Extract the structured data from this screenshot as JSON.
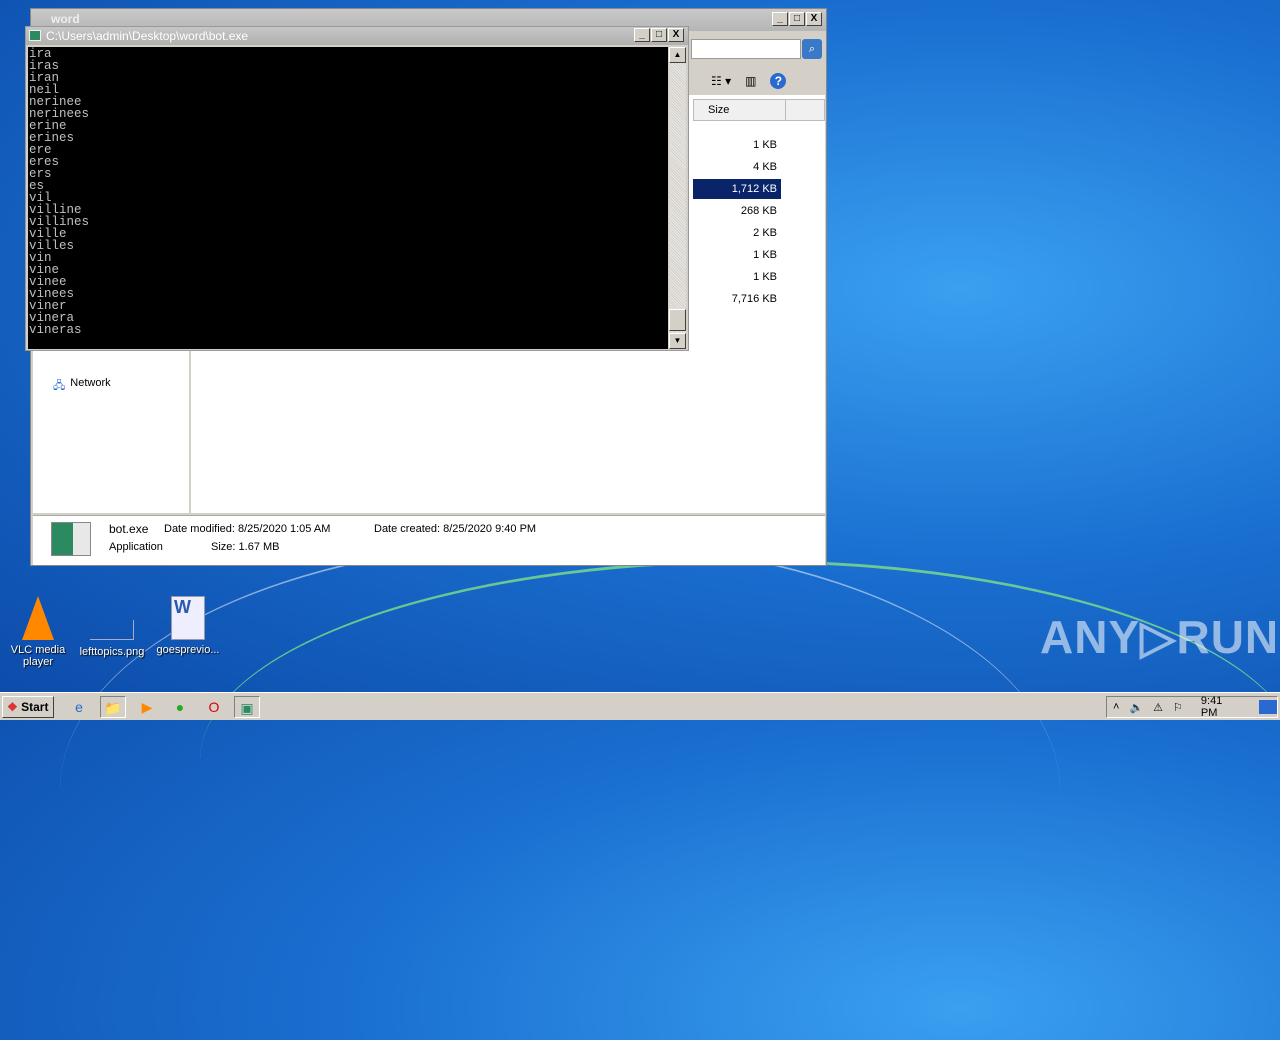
{
  "desktop": {
    "icons": [
      {
        "label": "VLC media player",
        "icon": "vlc-icon"
      },
      {
        "label": "lefttopics.png",
        "icon": "image-icon"
      },
      {
        "label": "goesprevio...",
        "icon": "word-doc-icon"
      }
    ],
    "watermark": "ANY ▷ RUN"
  },
  "explorer": {
    "title": "word",
    "column_size": "Size",
    "sizes": [
      "1 KB",
      "4 KB",
      "1,712 KB",
      "268 KB",
      "2 KB",
      "1 KB",
      "1 KB",
      "7,716 KB"
    ],
    "selected_index": 2,
    "nav_network": "Network",
    "details": {
      "name": "bot.exe",
      "type": "Application",
      "date_modified_label": "Date modified:",
      "date_modified": "8/25/2020 1:05 AM",
      "date_created_label": "Date created:",
      "date_created": "8/25/2020 9:40 PM",
      "size_label": "Size:",
      "size": "1.67 MB"
    }
  },
  "console": {
    "title": "C:\\Users\\admin\\Desktop\\word\\bot.exe",
    "lines": [
      "ira",
      "iras",
      "iran",
      "neil",
      "nerinee",
      "nerinees",
      "erine",
      "erines",
      "ere",
      "eres",
      "ers",
      "es",
      "vil",
      "villine",
      "villines",
      "ville",
      "villes",
      "vin",
      "vine",
      "vinee",
      "vinees",
      "viner",
      "vinera",
      "vineras"
    ]
  },
  "taskbar": {
    "start": "Start",
    "clock": "9:41 PM"
  }
}
